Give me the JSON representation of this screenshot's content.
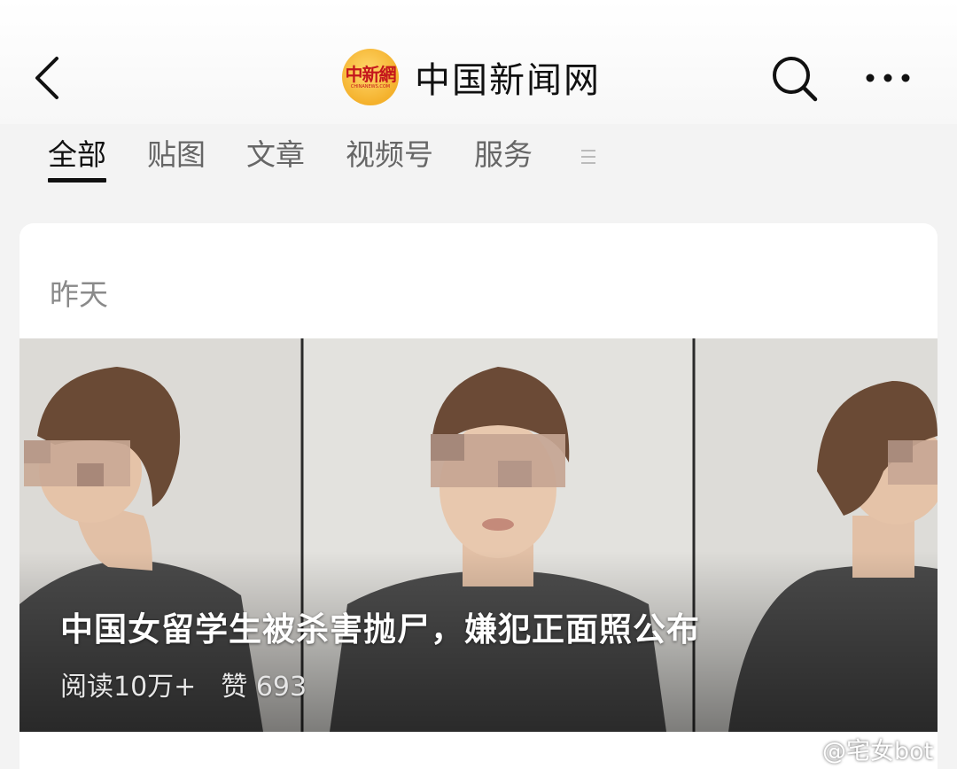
{
  "header": {
    "logo_text": "中新網",
    "logo_subtext": "CHINANEWS.COM",
    "account_name": "中国新闻网"
  },
  "tabs": [
    {
      "label": "全部",
      "active": true
    },
    {
      "label": "贴图",
      "active": false
    },
    {
      "label": "文章",
      "active": false
    },
    {
      "label": "视频号",
      "active": false
    },
    {
      "label": "服务",
      "active": false
    }
  ],
  "feed": {
    "date_label": "昨天",
    "article": {
      "title": "中国女留学生被杀害抛尸，嫌犯正面照公布",
      "reads": "阅读10万+",
      "likes": "赞 693"
    }
  },
  "watermark": "@宅女bot",
  "icons": [
    "back-arrow-icon",
    "search-icon",
    "more-icon",
    "tab-more-icon"
  ],
  "colors": {
    "logo_bg": "#f4b12c",
    "logo_text": "#c4161c",
    "tab_active": "#111111"
  }
}
